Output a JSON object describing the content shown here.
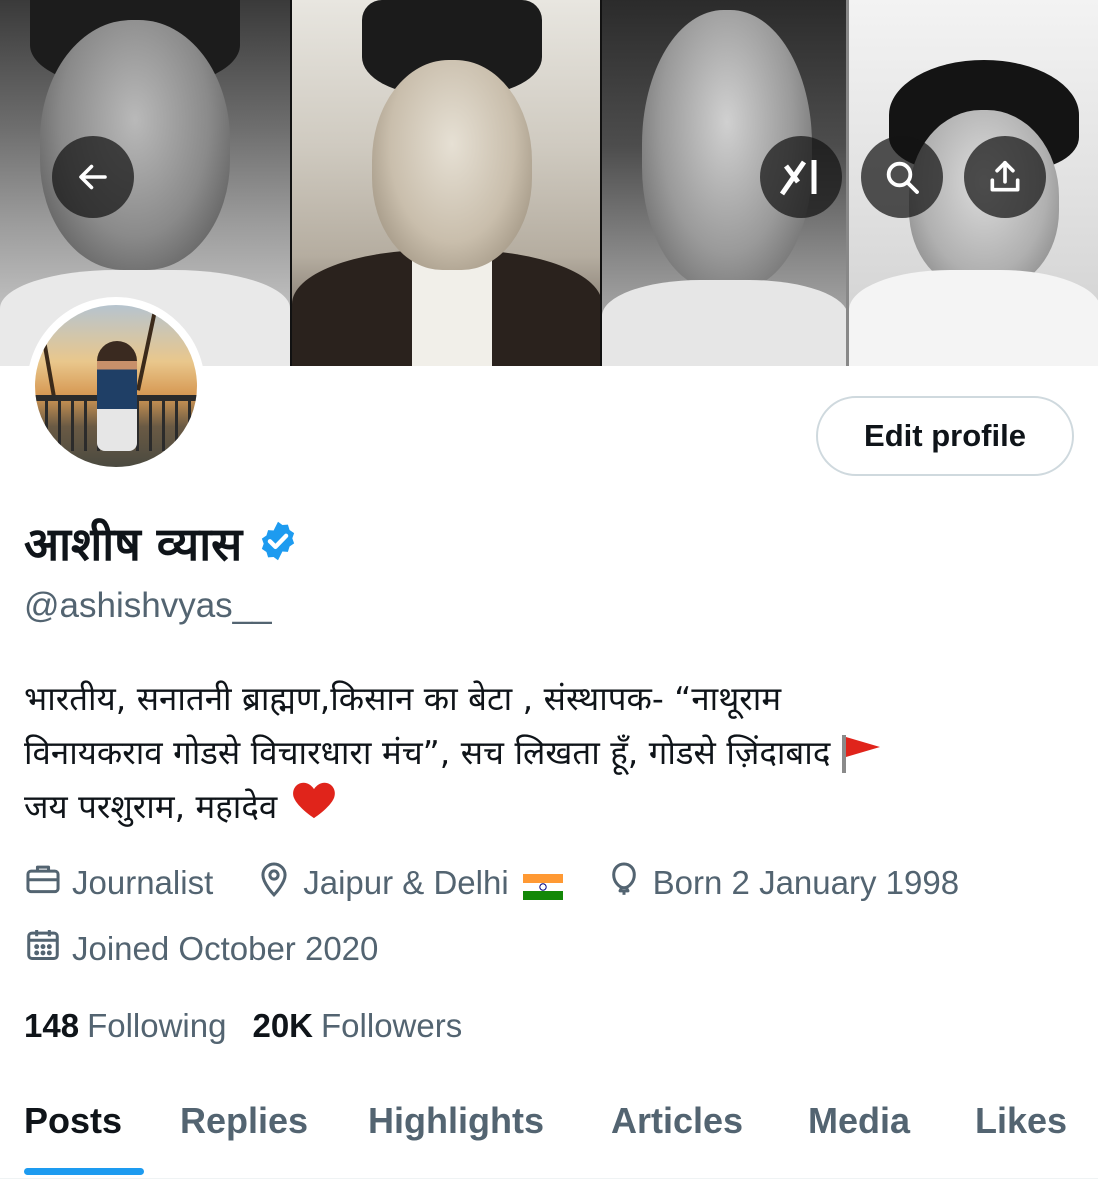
{
  "header": {
    "back_icon": "arrow-left-icon",
    "grok_icon": "grok-icon",
    "search_icon": "search-icon",
    "share_icon": "share-icon"
  },
  "profile": {
    "name": "आशीष व्यास",
    "verified": true,
    "handle": "@ashishvyas__",
    "edit_label": "Edit profile",
    "bio_lines": [
      "भारतीय, सनातनी ब्राह्मण,किसान का बेटा , संस्थापक- “नाथूराम",
      "विनायकराव गोडसे विचारधारा मंच”, सच लिखता हूँ, गोडसे ज़िंदाबाद",
      "जय परशुराम, महादेव"
    ],
    "occupation": "Journalist",
    "location": "Jaipur & Delhi",
    "birthday": "Born 2 January 1998",
    "joined": "Joined October 2020"
  },
  "stats": {
    "following_count": "148",
    "following_label": "Following",
    "followers_count": "20K",
    "followers_label": "Followers"
  },
  "tabs": [
    "Posts",
    "Replies",
    "Highlights",
    "Articles",
    "Media",
    "Likes"
  ],
  "active_tab": "Posts",
  "colors": {
    "accent": "#1d9bf0",
    "text_primary": "#0f1419",
    "text_secondary": "#536471"
  }
}
